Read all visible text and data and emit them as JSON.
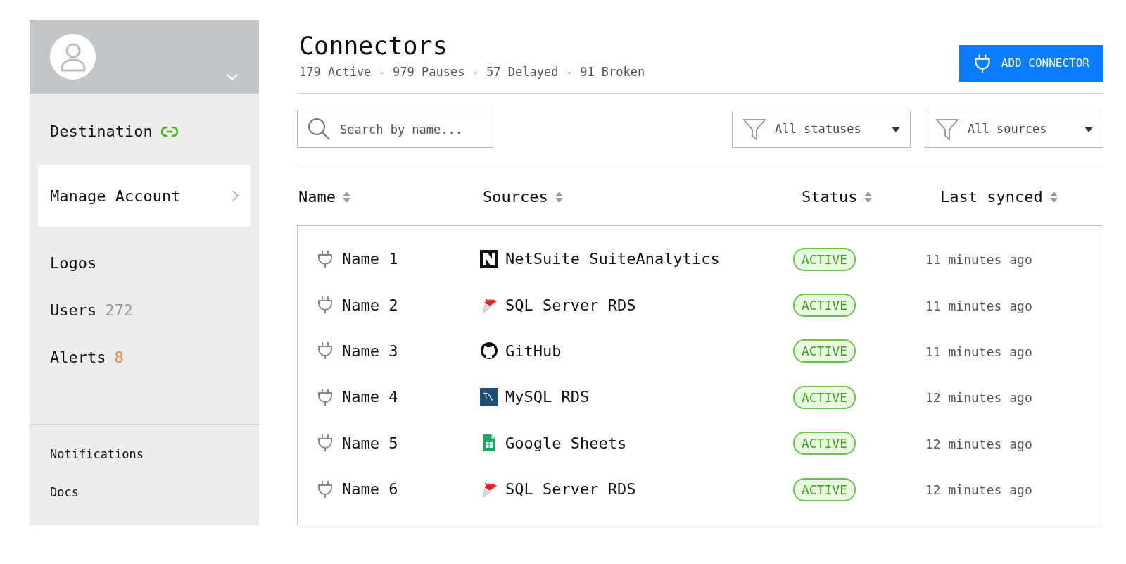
{
  "sidebar": {
    "items": [
      {
        "label": "Destination",
        "kind": "linked",
        "selected": false
      },
      {
        "label": "Manage Account",
        "kind": "chevron",
        "selected": true
      },
      {
        "label": "Logos",
        "kind": "plain",
        "selected": false
      },
      {
        "label": "Users",
        "kind": "count",
        "count": "272",
        "color": "#9a9a9a",
        "selected": false
      },
      {
        "label": "Alerts",
        "kind": "count",
        "count": "8",
        "color": "#f0883e",
        "selected": false
      }
    ],
    "footer_links": [
      "Notifications",
      "Docs"
    ]
  },
  "header": {
    "title": "Connectors",
    "summary": "179 Active - 979 Pauses - 57 Delayed - 91 Broken",
    "button": "ADD CONNECTOR"
  },
  "search": {
    "placeholder": "Search by name..."
  },
  "filters": [
    "All statuses",
    "All sources"
  ],
  "table": {
    "columns": [
      "Name",
      "Sources",
      "Status",
      "Last synced"
    ],
    "rows": [
      {
        "name": "Name 1",
        "source": "NetSuite SuiteAnalytics",
        "kind": "netsuite",
        "status": "ACTIVE",
        "last_synced": "11 minutes ago"
      },
      {
        "name": "Name 2",
        "source": "SQL Server RDS",
        "kind": "sqlserver",
        "status": "ACTIVE",
        "last_synced": "11 minutes ago"
      },
      {
        "name": "Name 3",
        "source": "GitHub",
        "kind": "github",
        "status": "ACTIVE",
        "last_synced": "11 minutes ago"
      },
      {
        "name": "Name 4",
        "source": "MySQL RDS",
        "kind": "mysql",
        "status": "ACTIVE",
        "last_synced": "12 minutes ago"
      },
      {
        "name": "Name 5",
        "source": "Google Sheets",
        "kind": "sheets",
        "status": "ACTIVE",
        "last_synced": "12 minutes ago"
      },
      {
        "name": "Name 6",
        "source": "SQL Server RDS",
        "kind": "sqlserver",
        "status": "ACTIVE",
        "last_synced": "12 minutes ago"
      }
    ]
  }
}
